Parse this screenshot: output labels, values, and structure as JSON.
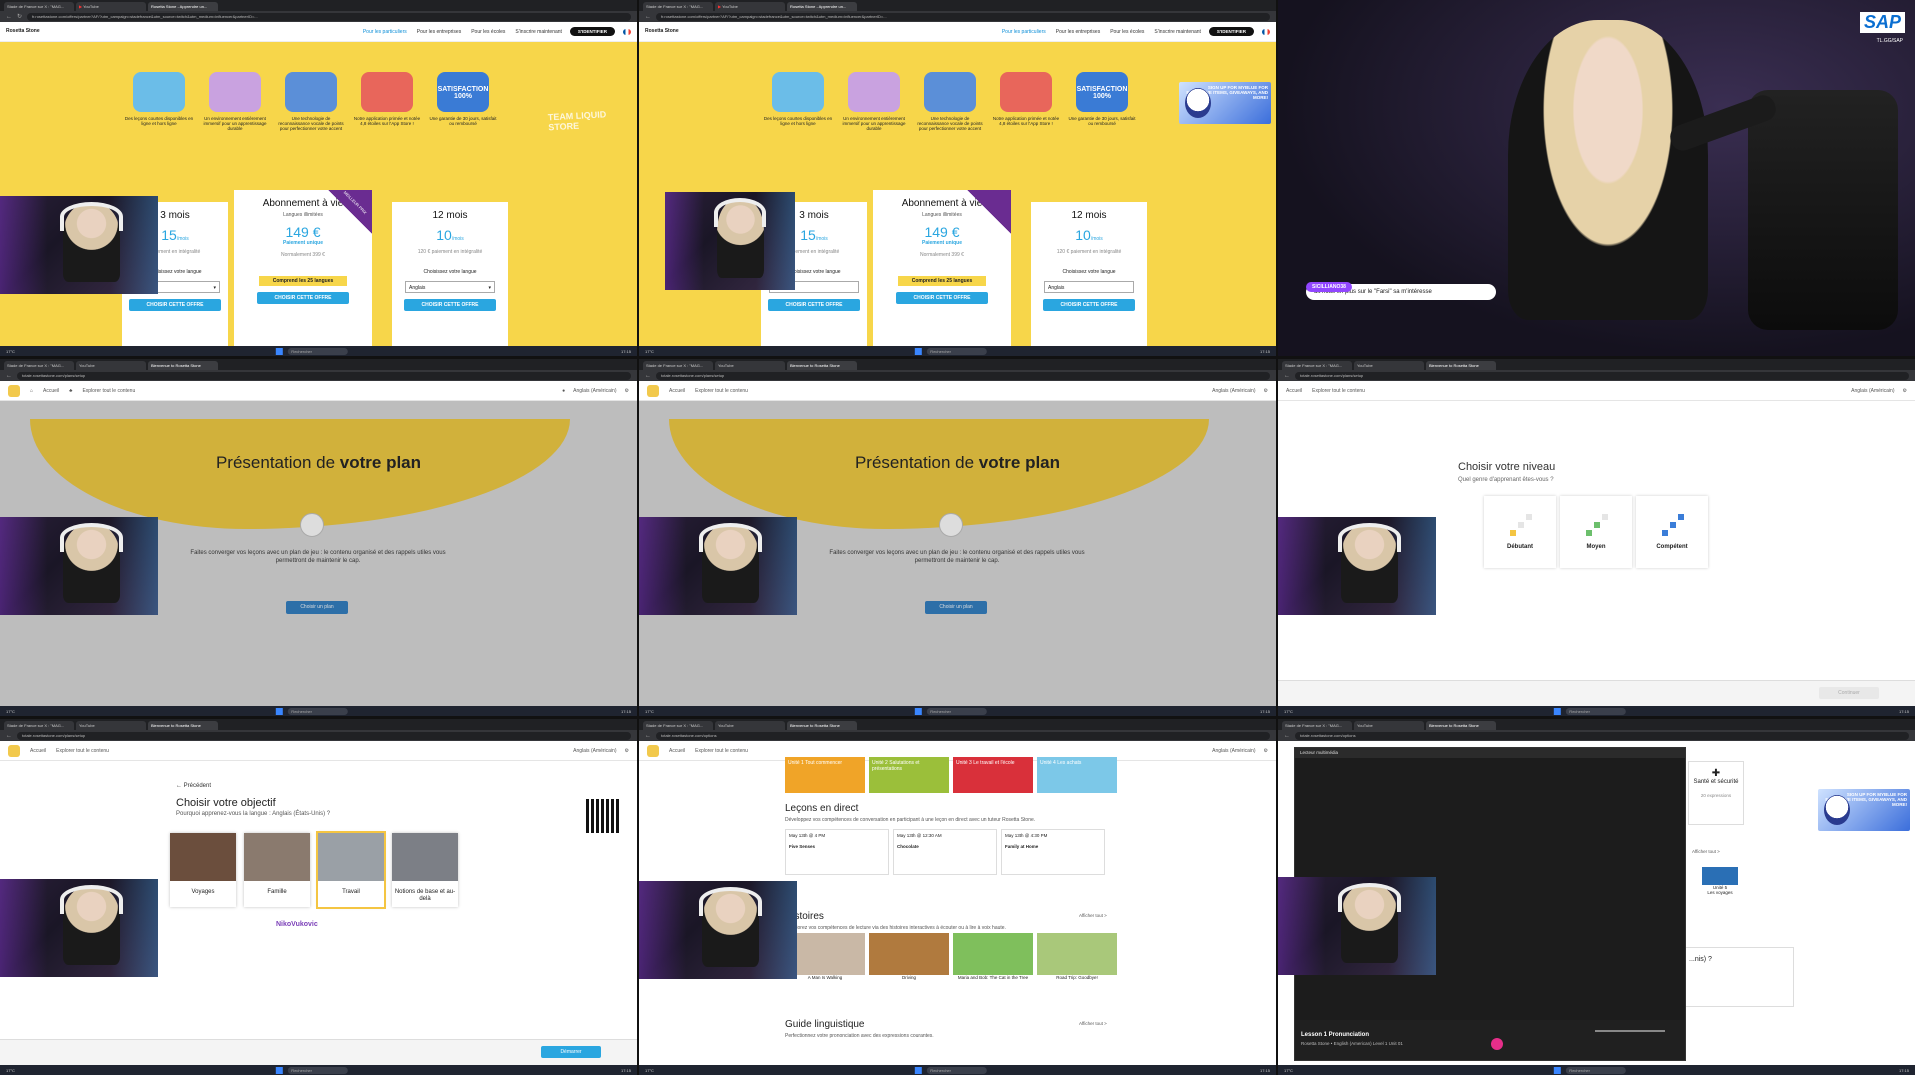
{
  "browser": {
    "tab_sites": "Stade de France sur X : \"MAG...",
    "tab_youtube": "YouTube",
    "tab_rosetta": "Rosetta Stone - Apprendre un...",
    "tab_welcome": "Bienvenue to Rosetta Stone",
    "url_pricing": "fr.rosettastone.com/offers/partner?AF/?utm_campaign=stadefrance&utm_source=twitch&utm_medium=influencer&partnerID=...",
    "url_plan": "totale.rosettastone.com/plans/setup",
    "url_options": "totale.rosettastone.com/options"
  },
  "taskbar": {
    "weather": "17°C",
    "weather_sub": "Nuageux",
    "search": "Rechercher",
    "lang": "FRA",
    "time": "17:15",
    "date": "11/06/2024"
  },
  "rosetta": {
    "logo": "Rosetta Stone",
    "nav": [
      "Pour les particuliers",
      "Pour les entreprises",
      "Pour les écoles"
    ],
    "signup": "S'inscrire maintenant",
    "login": "S'IDENTIFIER",
    "features": [
      "Des leçons courtes disponibles en ligne et hors ligne",
      "Un environnement entièrement immersif pour un apprentissage durable",
      "Une technologie de reconnaissance vocale de points pour perfectionner votre accent",
      "Notre application primée et notée 4,8 étoiles sur l'App Store !",
      "Une garantie de 30 jours, satisfait ou remboursé"
    ],
    "satisfaction": "SATISFACTION 100%",
    "team_text": "TEAM LIQUID STORE",
    "plans": [
      {
        "title": "3 mois",
        "price": "15",
        "unit": "/mois",
        "note": "paiement en intégralité"
      },
      {
        "title": "Abonnement à vie",
        "langs": "Langues illimitées",
        "price": "149 €",
        "pay": "Paiement unique",
        "normal": "Normalement 399 €",
        "tag": "Comprend les 25 langues"
      },
      {
        "title": "12 mois",
        "price": "10",
        "unit": "/mois",
        "note": "120 € paiement en intégralité"
      }
    ],
    "ribbon": "MEILLEUR PRIX",
    "choose_lang": "Choisissez votre langue",
    "lang_value": "Anglais",
    "cta": "CHOISIR CETTE OFFRE"
  },
  "stream": {
    "sponsor": "SAP",
    "sponsor_sub": "TL.GG/SAP",
    "chat_user": "SICILLIANO38",
    "chat_msg": "dit nous en plus sur le \"Farsi\" sa m'intéresse"
  },
  "app": {
    "home": "Accueil",
    "explore": "Explorer tout le contenu",
    "user": "Anglais (Américain)",
    "plan_title_a": "Présentation de",
    "plan_title_b": "votre plan",
    "plan_desc": "Faites converger vos leçons avec un plan de jeu : le contenu organisé et des rappels utiles vous permettront de maintenir le cap.",
    "plan_btn": "Choisir un plan",
    "level_title": "Choisir votre niveau",
    "level_sub": "Quel genre d'apprenant êtes-vous ?",
    "levels": [
      "Débutant",
      "Moyen",
      "Compétent"
    ],
    "level_continue": "Continuer",
    "prev": "Précédent",
    "obj_title": "Choisir votre objectif",
    "obj_sub": "Pourquoi apprenez-vous la langue : Anglais (États-Unis) ?",
    "objectives": [
      "Voyages",
      "Famille",
      "Travail",
      "Notions de base et au-delà"
    ],
    "obj_continue": "Démarrer",
    "watermark_user": "NikoVukovic"
  },
  "options": {
    "units": [
      "Unité 1 Tout commencer",
      "Unité 2 Salutations et présentations",
      "Unité 3 Le travail et l'école",
      "Unité 4 Les achats"
    ],
    "live_title": "Leçons en direct",
    "live_sub": "Développez vos compétences de conversation en participant à une leçon en direct avec un tuteur Rosetta Stone.",
    "live": [
      {
        "date": "May 13th @ 4 PM",
        "title": "Five Senses"
      },
      {
        "date": "May 13th @ 12:30 AM",
        "title": "Chocolate"
      },
      {
        "date": "May 13th @ 4:30 PM",
        "title": "Family at Home"
      }
    ],
    "stories_title": "Histoires",
    "stories_sub": "Améliorez vos compétences de lecture via des histoires interactives à écouter ou à lire à voix haute.",
    "stories": [
      "A Man Is Walking",
      "Driving",
      "Maria and Bob: The Cat in the Tree",
      "Road Trip: Goodbye!"
    ],
    "see_all": "Afficher tout >",
    "guide_title": "Guide linguistique",
    "guide_sub": "Perfectionnez votre prononciation avec des expressions courantes."
  },
  "player": {
    "window": "Lecteur multimédia",
    "lesson": "Lesson 1 Pronunciation",
    "sub": "Rosetta Stone • English (American) Level 1 Unit 01",
    "side_title": "Santé et sécurité",
    "side_sub": "20 expressions",
    "side_unit": "Unité 5",
    "side_unit_sub": "Les voyages",
    "side_more": "Afficher tout >",
    "side_q": "...nis) ?"
  },
  "ad": {
    "text": "SIGN UP FOR MYBLUE FOR EXCLUSIVE ITEMS, GIVEAWAYS, AND MORE!"
  }
}
